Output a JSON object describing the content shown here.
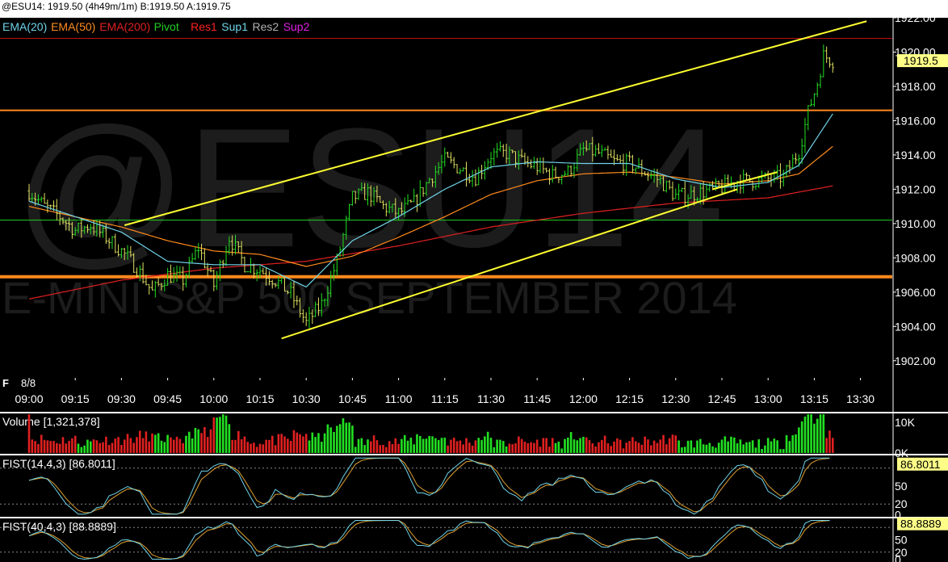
{
  "titlebar": {
    "text": "@ESU14: 1919.50 (4h49m/1m)  B:1919.50 A:1919.75"
  },
  "watermark": {
    "symbol": "@ESU14",
    "description": "E-MINI S&P 500 SEPTEMBER 2014"
  },
  "legend": [
    {
      "label": "EMA(20)",
      "color": "#6fd3e8"
    },
    {
      "label": "EMA(50)",
      "color": "#ff8a1e"
    },
    {
      "label": "EMA(200)",
      "color": "#e02020"
    },
    {
      "label": "Pivot",
      "color": "#22d022"
    },
    {
      "label": "Res1",
      "color": "#ff2020"
    },
    {
      "label": "Sup1",
      "color": "#6fd3e8"
    },
    {
      "label": "Res2",
      "color": "#b0b0b0"
    },
    {
      "label": "Sup2",
      "color": "#e020e0"
    }
  ],
  "colors": {
    "up_bar": "#22e022",
    "down_bar": "#e02020",
    "price_bar": "#e0e060",
    "trendline": "#ffff30",
    "level_orange": "#ff8a1e",
    "level_green": "#22d022",
    "level_red": "#c01010",
    "current_price_bg": "#ffff88"
  },
  "chart_data": {
    "type": "line",
    "date_label": "8/8",
    "flag": "F",
    "time_ticks": [
      "09:00",
      "09:15",
      "09:30",
      "09:45",
      "10:00",
      "10:15",
      "10:30",
      "10:45",
      "11:00",
      "11:15",
      "11:30",
      "11:45",
      "12:00",
      "12:15",
      "12:30",
      "12:45",
      "13:00",
      "13:15",
      "13:30"
    ],
    "price_axis": {
      "ylim": [
        1901,
        1922
      ],
      "ticks": [
        "1922.00",
        "1920.00",
        "1918.00",
        "1916.00",
        "1914.00",
        "1912.00",
        "1910.00",
        "1908.00",
        "1906.00",
        "1904.00",
        "1902.00"
      ]
    },
    "current_price": "1919.5",
    "horizontal_levels": [
      {
        "name": "Res1",
        "value": 1920.8
      },
      {
        "name": "Orange upper",
        "value": 1916.6
      },
      {
        "name": "Pivot",
        "value": 1910.2
      },
      {
        "name": "Orange lower",
        "value": 1906.9
      }
    ],
    "trendlines": [
      {
        "from": [
          "09:31",
          1909.9
        ],
        "to": [
          "13:32",
          1921.8
        ]
      },
      {
        "from": [
          "10:22",
          1903.3
        ],
        "to": [
          "12:50",
          1912.0
        ]
      },
      {
        "from": [
          "12:42",
          1912.0
        ],
        "to": [
          "13:03",
          1913.0
        ]
      }
    ],
    "price_path": [
      [
        "09:00",
        1911.9
      ],
      [
        "09:05",
        1911.0
      ],
      [
        "09:10",
        1910.4
      ],
      [
        "09:15",
        1909.6
      ],
      [
        "09:20",
        1909.9
      ],
      [
        "09:25",
        1909.2
      ],
      [
        "09:30",
        1908.4
      ],
      [
        "09:35",
        1907.4
      ],
      [
        "09:40",
        1906.0
      ],
      [
        "09:45",
        1907.0
      ],
      [
        "09:50",
        1906.7
      ],
      [
        "09:55",
        1908.6
      ],
      [
        "10:00",
        1906.4
      ],
      [
        "10:05",
        1909.2
      ],
      [
        "10:10",
        1907.6
      ],
      [
        "10:15",
        1907.3
      ],
      [
        "10:20",
        1906.7
      ],
      [
        "10:25",
        1905.9
      ],
      [
        "10:30",
        1904.2
      ],
      [
        "10:35",
        1905.3
      ],
      [
        "10:40",
        1907.8
      ],
      [
        "10:45",
        1911.5
      ],
      [
        "10:50",
        1911.8
      ],
      [
        "10:55",
        1911.0
      ],
      [
        "11:00",
        1910.6
      ],
      [
        "11:05",
        1911.2
      ],
      [
        "11:10",
        1912.6
      ],
      [
        "11:15",
        1913.7
      ],
      [
        "11:20",
        1913.2
      ],
      [
        "11:25",
        1912.7
      ],
      [
        "11:30",
        1914.0
      ],
      [
        "11:35",
        1914.1
      ],
      [
        "11:40",
        1913.6
      ],
      [
        "11:45",
        1913.3
      ],
      [
        "11:50",
        1912.8
      ],
      [
        "11:55",
        1913.0
      ],
      [
        "12:00",
        1914.3
      ],
      [
        "12:05",
        1914.1
      ],
      [
        "12:10",
        1913.6
      ],
      [
        "12:15",
        1913.5
      ],
      [
        "12:20",
        1913.0
      ],
      [
        "12:25",
        1912.5
      ],
      [
        "12:30",
        1911.6
      ],
      [
        "12:35",
        1911.7
      ],
      [
        "12:40",
        1911.9
      ],
      [
        "12:45",
        1912.1
      ],
      [
        "12:50",
        1912.5
      ],
      [
        "12:55",
        1912.5
      ],
      [
        "13:00",
        1912.6
      ],
      [
        "13:05",
        1912.7
      ],
      [
        "13:10",
        1914.2
      ],
      [
        "13:13",
        1916.5
      ],
      [
        "13:16",
        1918.2
      ],
      [
        "13:18",
        1919.8
      ],
      [
        "13:21",
        1919.5
      ]
    ],
    "ema20": [
      [
        "09:00",
        1911.3
      ],
      [
        "09:30",
        1909.5
      ],
      [
        "09:45",
        1907.8
      ],
      [
        "10:00",
        1907.6
      ],
      [
        "10:15",
        1907.6
      ],
      [
        "10:30",
        1906.3
      ],
      [
        "10:45",
        1909.0
      ],
      [
        "11:00",
        1910.4
      ],
      [
        "11:15",
        1912.0
      ],
      [
        "11:30",
        1913.3
      ],
      [
        "11:45",
        1913.6
      ],
      [
        "12:00",
        1913.5
      ],
      [
        "12:15",
        1913.5
      ],
      [
        "12:30",
        1912.6
      ],
      [
        "12:45",
        1912.1
      ],
      [
        "13:00",
        1912.4
      ],
      [
        "13:10",
        1913.4
      ],
      [
        "13:21",
        1916.4
      ]
    ],
    "ema50": [
      [
        "09:00",
        1911.0
      ],
      [
        "09:30",
        1909.8
      ],
      [
        "09:45",
        1909.0
      ],
      [
        "10:00",
        1908.4
      ],
      [
        "10:15",
        1908.2
      ],
      [
        "10:30",
        1907.5
      ],
      [
        "10:45",
        1908.1
      ],
      [
        "11:00",
        1909.2
      ],
      [
        "11:15",
        1910.4
      ],
      [
        "11:30",
        1911.7
      ],
      [
        "11:45",
        1912.5
      ],
      [
        "12:00",
        1912.9
      ],
      [
        "12:15",
        1913.0
      ],
      [
        "12:30",
        1912.7
      ],
      [
        "12:45",
        1912.3
      ],
      [
        "13:00",
        1912.5
      ],
      [
        "13:10",
        1912.9
      ],
      [
        "13:21",
        1914.5
      ]
    ],
    "ema200": [
      [
        "09:00",
        1905.6
      ],
      [
        "09:30",
        1906.7
      ],
      [
        "10:00",
        1907.4
      ],
      [
        "10:30",
        1907.8
      ],
      [
        "11:00",
        1908.7
      ],
      [
        "11:30",
        1909.8
      ],
      [
        "12:00",
        1910.6
      ],
      [
        "12:30",
        1911.2
      ],
      [
        "13:00",
        1911.5
      ],
      [
        "13:21",
        1912.2
      ]
    ],
    "volume_panel": {
      "label": "Volume",
      "value": "[1,321,378]",
      "ticks": [
        "10K",
        "0K"
      ],
      "ylim": [
        0,
        12000
      ]
    },
    "fist1_panel": {
      "label": "FIST(14,4,3)",
      "value": "[86.8011]",
      "ticks": [
        "50",
        "20",
        "0"
      ],
      "current": "86.8011",
      "ylim": [
        0,
        100
      ]
    },
    "fist2_panel": {
      "label": "FIST(40,4,3)",
      "value": "[88.8889]",
      "ticks": [
        "50",
        "20",
        "0"
      ],
      "current": "88.8889",
      "ylim": [
        0,
        100
      ]
    }
  }
}
